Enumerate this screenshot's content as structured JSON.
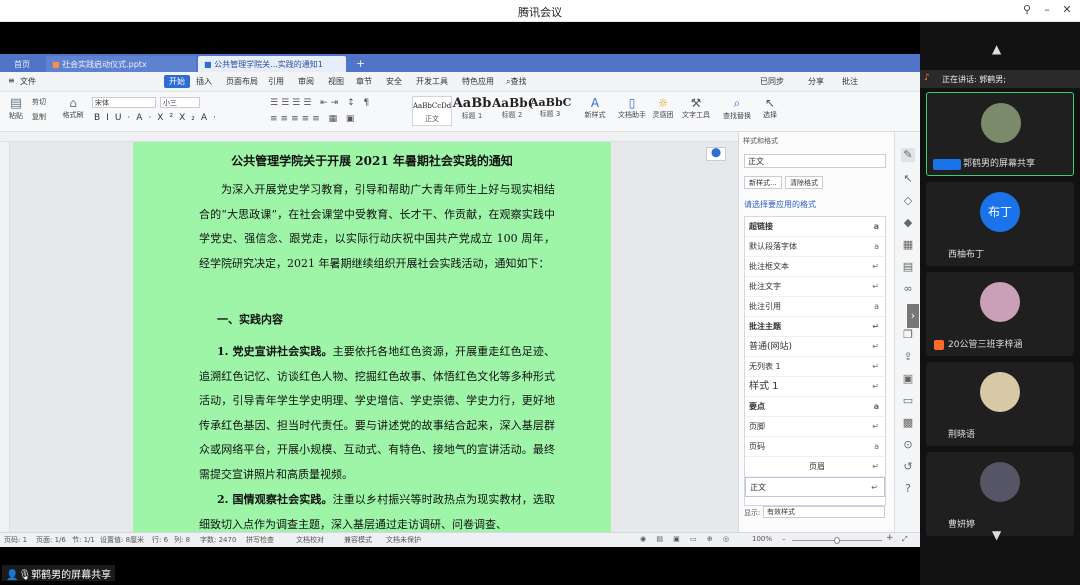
{
  "window": {
    "title": "腾讯会议"
  },
  "tabs": [
    {
      "label": "首页"
    },
    {
      "label": "社会实践启动仪式.pptx"
    },
    {
      "label": "公共管理学院关...实践的通知1"
    }
  ],
  "menus": [
    "文件",
    "开始",
    "插入",
    "页面布局",
    "引用",
    "审阅",
    "视图",
    "章节",
    "安全",
    "开发工具",
    "特色应用",
    "查找"
  ],
  "menu_right": [
    "已同步",
    "分享",
    "批注"
  ],
  "ribbon": {
    "paste": "粘贴",
    "cut": "剪切",
    "copy": "复制",
    "format_painter": "格式刷",
    "font": "宋体",
    "size": "小三",
    "styles": [
      {
        "sample": "AaBbCcDd",
        "name": "正文"
      },
      {
        "sample": "AaBb",
        "name": "标题 1"
      },
      {
        "sample": "AaBb(",
        "name": "标题 2"
      },
      {
        "sample": "AaBbC",
        "name": "标题 3"
      }
    ],
    "new_style": "新样式",
    "doc_assistant": "文档助手",
    "inspire": "灵感团",
    "text_tools": "文字工具",
    "find_replace": "查找替换",
    "select": "选择"
  },
  "document": {
    "title": "公共管理学院关于开展 2021 年暑期社会实践的通知",
    "intro": "为深入开展党史学习教育，引导和帮助广大青年师生上好与现实相结合的“大思政课”，在社会课堂中受教育、长才干、作贡献，在观察实践中学党史、强信念、跟党走，以实际行动庆祝中国共产党成立 100 周年，经学院研究决定，2021 年暑期继续组织开展社会实践活动，通知如下：",
    "section1": "一、实践内容",
    "item1_title": "1. 党史宣讲社会实践。",
    "item1_body": "主要依托各地红色资源，开展重走红色足迹、追溯红色记忆、访谈红色人物、挖掘红色故事、体悟红色文化等多种形式活动，引导青年学生学史明理、学史增信、学史崇德、学史力行，更好地传承红色基因、担当时代责任。要与讲述党的故事结合起来，深入基层群众或网络平台，开展小规模、互动式、有特色、接地气的宣讲活动。最终需提交宣讲照片和高质量视频。",
    "item2_title": "2. 国情观察社会实践。",
    "item2_body": "注重以乡村振兴等时政热点为现实教材，选取细致切入点作为调查主题，深入基层通过走访调研、问卷调查、"
  },
  "stylepane": {
    "header": "样式和格式",
    "current": "正文",
    "new_btn": "新样式...",
    "clear_btn": "清除格式",
    "choose_label": "请选择要应用的格式",
    "items": [
      {
        "name": "超链接",
        "mark": "a"
      },
      {
        "name": "默认段落字体",
        "mark": "a"
      },
      {
        "name": "批注框文本",
        "mark": "↵"
      },
      {
        "name": "批注文字",
        "mark": "↵"
      },
      {
        "name": "批注引用",
        "mark": "a"
      },
      {
        "name": "批注主题",
        "mark": "↵"
      },
      {
        "name": "普通(网站)",
        "mark": "↵"
      },
      {
        "name": "无列表 1",
        "mark": "↵"
      },
      {
        "name": "样式 1",
        "mark": "↵"
      },
      {
        "name": "要点",
        "mark": "a"
      },
      {
        "name": "页脚",
        "mark": "↵"
      },
      {
        "name": "页码",
        "mark": "a"
      },
      {
        "name": "页眉",
        "mark": "↵"
      },
      {
        "name": "正文",
        "mark": "↵"
      }
    ],
    "show_label": "显示:",
    "show_value": "有效样式"
  },
  "statusbar": {
    "page": "页码: 1",
    "pages": "页面: 1/6",
    "section": "节: 1/1",
    "setting": "设置值: 8厘米",
    "row": "行: 6",
    "col": "列: 8",
    "words": "字数: 2470",
    "spell": "拼写检查",
    "doc_proof": "文档校对",
    "compat": "兼容模式",
    "protect": "文档未保护",
    "zoom": "100%"
  },
  "participants": {
    "speaking_label": "正在讲话: 郭鹤男;",
    "tiles": [
      {
        "name": "郭鹤男的屏幕共享",
        "color": "#7a8a6a"
      },
      {
        "name": "西柚布丁",
        "color": "#1a73e8",
        "initials": "布丁"
      },
      {
        "name": "20公管三班李梓涵",
        "color": "#c9a0b8"
      },
      {
        "name": "荆晓语",
        "color": "#d8c8a8"
      },
      {
        "name": "曹妍婷",
        "color": "#555566"
      }
    ]
  },
  "share_label": "郭鹤男的屏幕共享"
}
